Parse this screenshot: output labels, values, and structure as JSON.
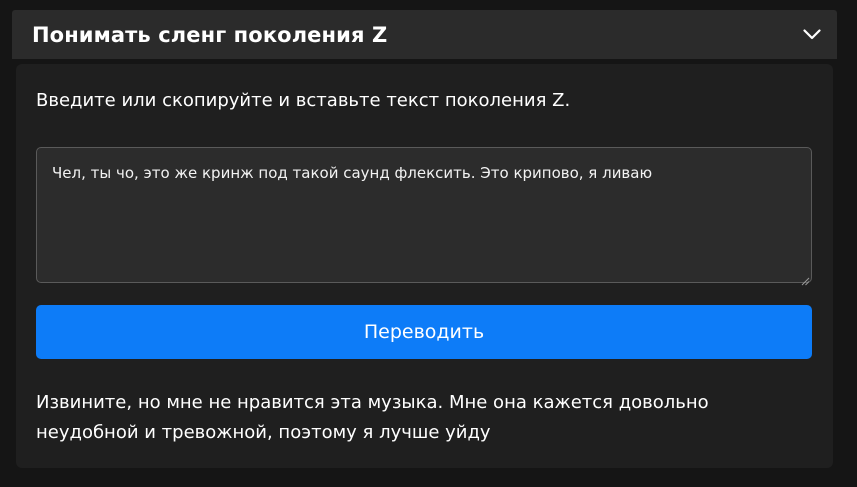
{
  "header": {
    "title": "Понимать сленг поколения Z",
    "toggle_icon": "chevron-down-icon"
  },
  "form": {
    "prompt": "Введите или скопируйте и вставьте текст поколения Z.",
    "input_value": "Чел, ты чо, это же кринж под такой саунд флексить. Это крипово, я ливаю",
    "button_label": "Переводить"
  },
  "result": {
    "text": "Извините, но мне не нравится эта музыка. Мне она кажется довольно неудобной и тревожной, поэтому я лучше уйду"
  },
  "colors": {
    "background": "#151515",
    "header": "#2b2b2b",
    "body": "#1f1f1f",
    "input": "#2c2c2c",
    "accent": "#0d7cf8",
    "text": "#ffffff"
  }
}
